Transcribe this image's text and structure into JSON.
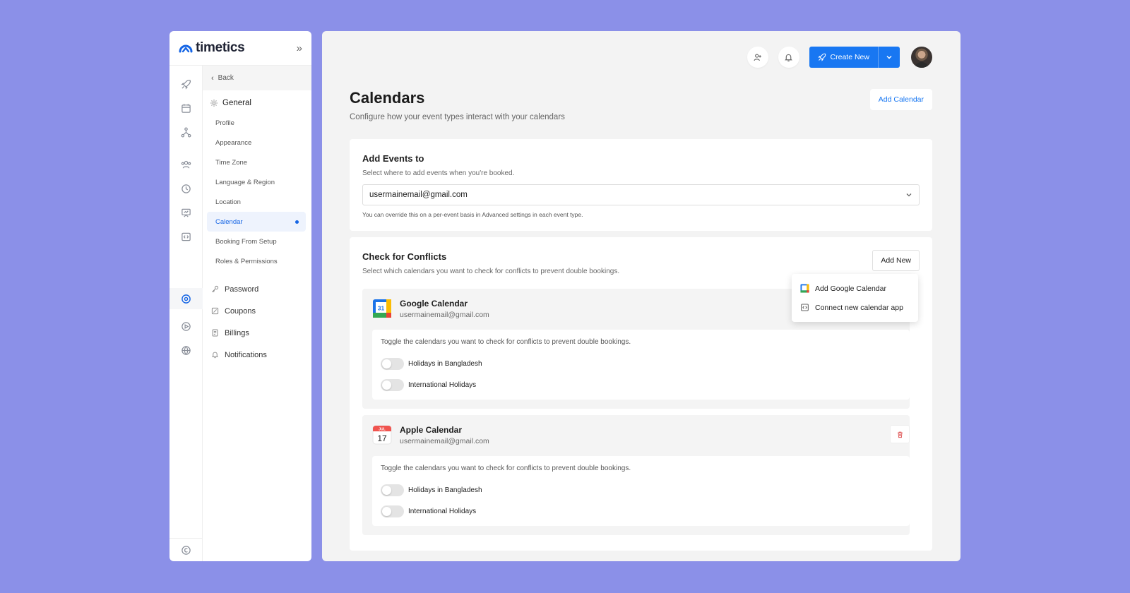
{
  "brand": {
    "name": "timetics"
  },
  "sidebar": {
    "back_label": "Back",
    "general_label": "General",
    "general_items": [
      {
        "label": "Profile"
      },
      {
        "label": "Appearance"
      },
      {
        "label": "Time Zone"
      },
      {
        "label": "Language & Region"
      },
      {
        "label": "Location"
      },
      {
        "label": "Calendar",
        "active": true
      },
      {
        "label": "Booking From Setup"
      },
      {
        "label": "Roles & Permissions"
      }
    ],
    "group_items": [
      {
        "label": "Password",
        "icon": "key-icon"
      },
      {
        "label": "Coupons",
        "icon": "coupon-icon"
      },
      {
        "label": "Billings",
        "icon": "billing-icon"
      },
      {
        "label": "Notifications",
        "icon": "bell-icon"
      }
    ],
    "rail_icons": [
      "rocket-icon",
      "calendar-icon",
      "network-icon",
      "team-icon",
      "clock-icon",
      "presentation-icon",
      "code-icon",
      "settings-icon",
      "play-icon",
      "globe-icon",
      "copyright-icon"
    ]
  },
  "header": {
    "create_label": "Create New"
  },
  "page": {
    "title": "Calendars",
    "subtitle": "Configure how your event types interact with your calendars",
    "add_calendar_label": "Add Calendar"
  },
  "add_events": {
    "title": "Add Events to",
    "subtitle": "Select where to add events when you're booked.",
    "selected": "usermainemail@gmail.com",
    "note": "You can override this on a per-event basis in Advanced settings in each event type."
  },
  "conflicts": {
    "title": "Check for Conflicts",
    "subtitle": "Select which calendars you want to check for conflicts to prevent double bookings.",
    "add_new_label": "Add New",
    "dropdown": [
      {
        "label": "Add Google Calendar"
      },
      {
        "label": "Connect new calendar app"
      }
    ],
    "calendars": [
      {
        "name": "Google Calendar",
        "email": "usermainemail@gmail.com",
        "logo_text": "31",
        "toggle_text": "Toggle the calendars you want to check for conflicts to prevent double bookings.",
        "toggles": [
          {
            "label": "Holidays in Bangladesh",
            "on": false
          },
          {
            "label": "International Holidays",
            "on": false
          }
        ]
      },
      {
        "name": "Apple Calendar",
        "email": "usermainemail@gmail.com",
        "logo_month": "JUL",
        "logo_day": "17",
        "toggle_text": "Toggle the calendars you want to check for conflicts to prevent double bookings.",
        "toggles": [
          {
            "label": "Holidays in Bangladesh",
            "on": false
          },
          {
            "label": "International Holidays",
            "on": false
          }
        ]
      }
    ]
  },
  "colors": {
    "accent": "#1877f2",
    "background": "#8b90e8",
    "danger": "#e05a5a"
  }
}
